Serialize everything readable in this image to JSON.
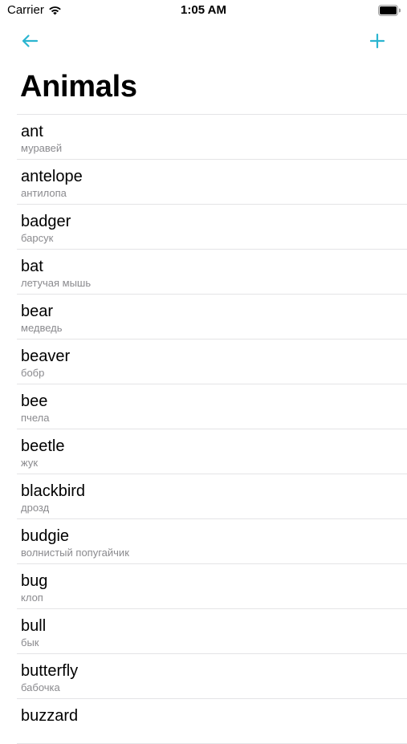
{
  "status_bar": {
    "carrier": "Carrier",
    "time": "1:05 AM",
    "wifi_icon": "wifi-icon",
    "battery_icon": "battery-icon"
  },
  "nav": {
    "back_icon": "arrow-left-icon",
    "add_icon": "plus-icon",
    "accent_color": "#2bb5d0"
  },
  "page_title": "Animals",
  "items": [
    {
      "title": "ant",
      "subtitle": "муравей"
    },
    {
      "title": "antelope",
      "subtitle": "антилопа"
    },
    {
      "title": "badger",
      "subtitle": "барсук"
    },
    {
      "title": "bat",
      "subtitle": "летучая мышь"
    },
    {
      "title": "bear",
      "subtitle": "медведь"
    },
    {
      "title": "beaver",
      "subtitle": "бобр"
    },
    {
      "title": "bee",
      "subtitle": "пчела"
    },
    {
      "title": "beetle",
      "subtitle": "жук"
    },
    {
      "title": "blackbird",
      "subtitle": "дрозд"
    },
    {
      "title": "budgie",
      "subtitle": "волнистый попугайчик"
    },
    {
      "title": "bug",
      "subtitle": "клоп"
    },
    {
      "title": "bull",
      "subtitle": "бык"
    },
    {
      "title": "butterfly",
      "subtitle": "бабочка"
    },
    {
      "title": "buzzard",
      "subtitle": ""
    }
  ]
}
